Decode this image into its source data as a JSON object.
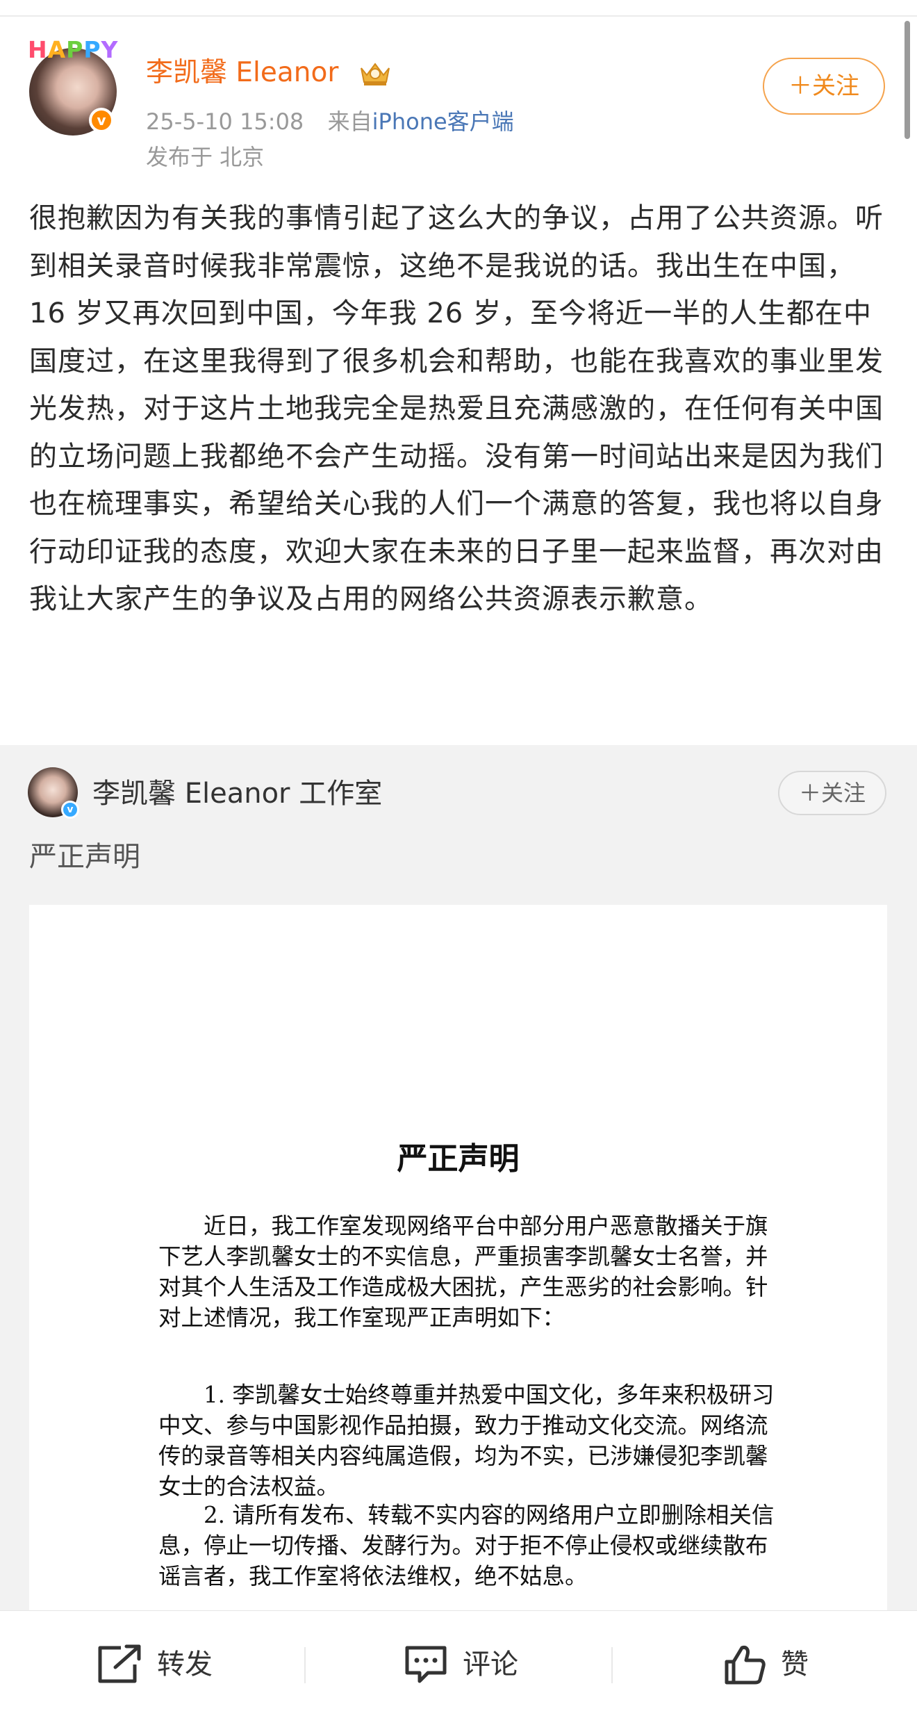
{
  "post": {
    "badge_text": "HAPPY",
    "author": "李凯馨 Eleanor",
    "time": "25-5-10 15:08",
    "source_prefix": "来自",
    "source_client": "iPhone客户端",
    "location": "发布于 北京",
    "follow_label": "＋关注",
    "body": "很抱歉因为有关我的事情引起了这么大的争议，占用了公共资源。听到相关录音时候我非常震惊，这绝不是我说的话。我出生在中国，16 岁又再次回到中国，今年我 26 岁，至今将近一半的人生都在中国度过，在这里我得到了很多机会和帮助，也能在我喜欢的事业里发光发热，对于这片土地我完全是热爱且充满感激的，在任何有关中国的立场问题上我都绝不会产生动摇。没有第一时间站出来是因为我们也在梳理事实，希望给关心我的人们一个满意的答复，我也将以自身行动印证我的态度，欢迎大家在未来的日子里一起来监督，再次对由我让大家产生的争议及占用的网络公共资源表示歉意。"
  },
  "retweet": {
    "author": "李凯馨 Eleanor 工作室",
    "follow_label": "＋关注",
    "text": "严正声明",
    "document": {
      "title": "严正声明",
      "intro": "近日，我工作室发现网络平台中部分用户恶意散播关于旗下艺人李凯馨女士的不实信息，严重损害李凯馨女士名誉，并对其个人生活及工作造成极大困扰，产生恶劣的社会影响。针对上述情况，我工作室现严正声明如下：",
      "point1": "1. 李凯馨女士始终尊重并热爱中国文化，多年来积极研习中文、参与中国影视作品拍摄，致力于推动文化交流。网络流传的录音等相关内容纯属造假，均为不实，已涉嫌侵犯李凯馨女士的合法权益。",
      "point2": "2. 请所有发布、转载不实内容的网络用户立即删除相关信息，停止一切传播、发酵行为。对于拒不停止侵权或继续散布谣言者，我工作室将依法维权，绝不姑息。"
    }
  },
  "actions": {
    "repost": "转发",
    "comment": "评论",
    "like": "赞"
  },
  "colors": {
    "username": "#f26b1a",
    "follow_border": "#f5a34d",
    "client_link": "#4a77b6",
    "retweet_bg": "#f2f2f2"
  },
  "icons": [
    "crown-icon",
    "verified-icon",
    "repost-icon",
    "comment-icon",
    "like-icon"
  ]
}
